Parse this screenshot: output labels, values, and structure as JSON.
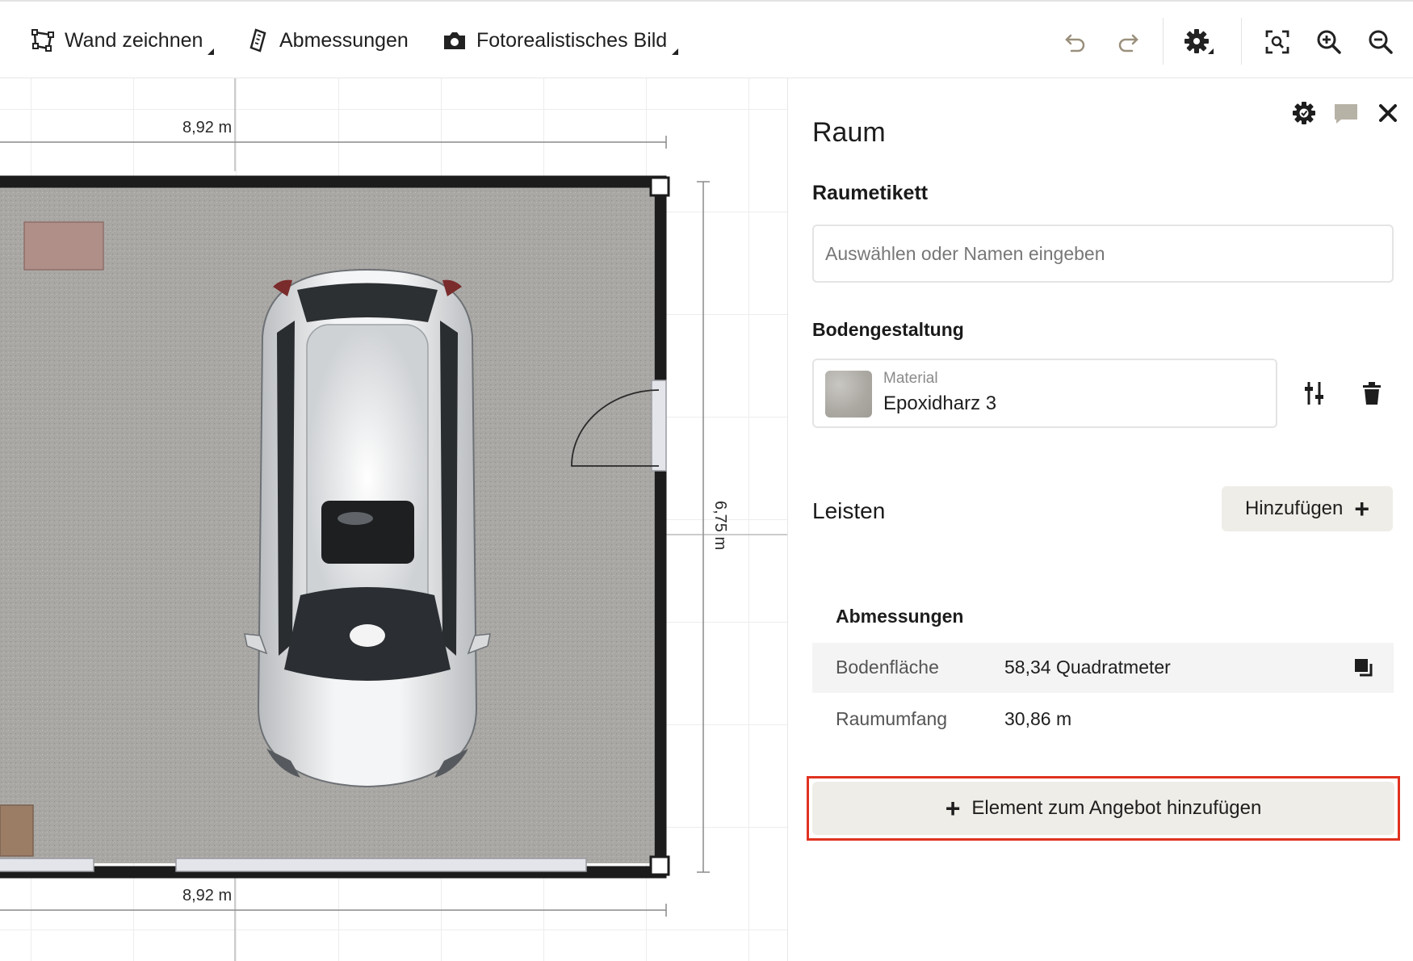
{
  "toolbar": {
    "draw_wall": "Wand zeichnen",
    "dimensions": "Abmessungen",
    "photo": "Fotorealistisches Bild",
    "icons": [
      "draw-wall-icon",
      "ruler-icon",
      "camera-icon",
      "undo-icon",
      "redo-icon",
      "settings-icon",
      "zoom-fit-icon",
      "zoom-in-icon",
      "zoom-out-icon"
    ]
  },
  "canvas": {
    "dim_top": "8,92 m",
    "dim_bottom": "8,92 m",
    "dim_right": "6,75 m",
    "floor_color": "#a9a7a4",
    "wall_color": "#1c1c1c"
  },
  "panel": {
    "title": "Raum",
    "room_label_heading": "Raumetikett",
    "room_label_placeholder": "Auswählen oder Namen eingeben",
    "floor_heading": "Bodengestaltung",
    "material_label": "Material",
    "material_value": "Epoxidharz 3",
    "skirting_heading": "Leisten",
    "add_button": "Hinzufügen",
    "dimensions_heading": "Abmessungen",
    "rows": [
      {
        "key": "Bodenfläche",
        "value": "58,34 Quadratmeter"
      },
      {
        "key": "Raumumfang",
        "value": "30,86 m"
      }
    ],
    "offer_button": "Element zum Angebot hinzufügen",
    "highlight_color": "#e0321f"
  }
}
